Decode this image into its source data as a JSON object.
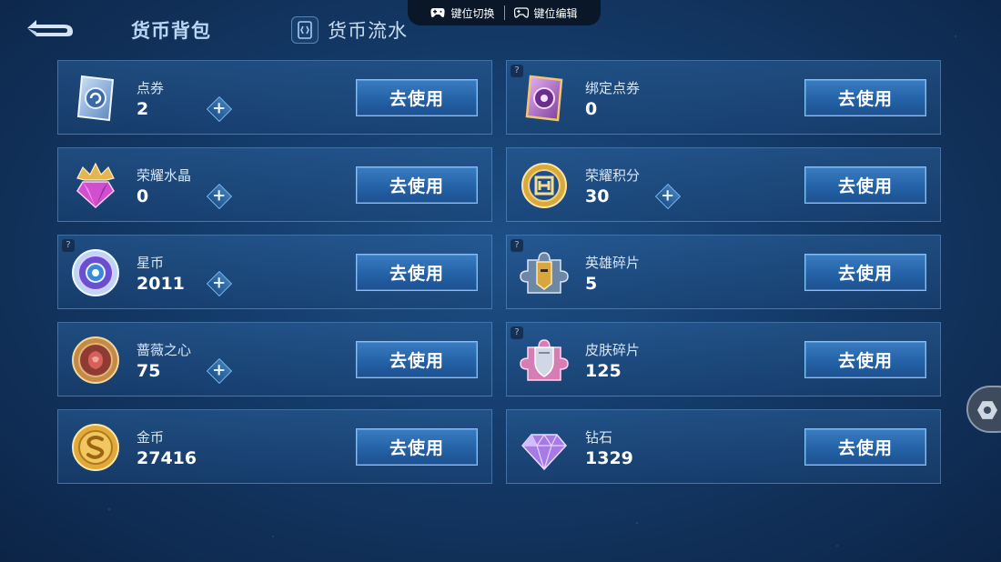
{
  "header": {
    "active_tab": "货币背包",
    "flow_tab": "货币流水"
  },
  "overlay": {
    "key_switch": "键位切换",
    "key_edit": "键位编辑"
  },
  "use_label": "去使用",
  "plus_label": "+",
  "currencies": [
    {
      "name": "点券",
      "amount": "2",
      "icon": "ticket-icon",
      "plus": true,
      "help": false
    },
    {
      "name": "绑定点券",
      "amount": "0",
      "icon": "bound-ticket-icon",
      "plus": false,
      "help": true
    },
    {
      "name": "荣耀水晶",
      "amount": "0",
      "icon": "crystal-icon",
      "plus": true,
      "help": false
    },
    {
      "name": "荣耀积分",
      "amount": "30",
      "icon": "honor-points-icon",
      "plus": true,
      "help": false
    },
    {
      "name": "星币",
      "amount": "2011",
      "icon": "star-coin-icon",
      "plus": true,
      "help": true
    },
    {
      "name": "英雄碎片",
      "amount": "5",
      "icon": "hero-shard-icon",
      "plus": false,
      "help": true
    },
    {
      "name": "蔷薇之心",
      "amount": "75",
      "icon": "rose-heart-icon",
      "plus": true,
      "help": false
    },
    {
      "name": "皮肤碎片",
      "amount": "125",
      "icon": "skin-shard-icon",
      "plus": false,
      "help": true
    },
    {
      "name": "金币",
      "amount": "27416",
      "icon": "gold-coin-icon",
      "plus": false,
      "help": false
    },
    {
      "name": "钻石",
      "amount": "1329",
      "icon": "diamond-icon",
      "plus": false,
      "help": false
    }
  ],
  "help_mark": "?"
}
